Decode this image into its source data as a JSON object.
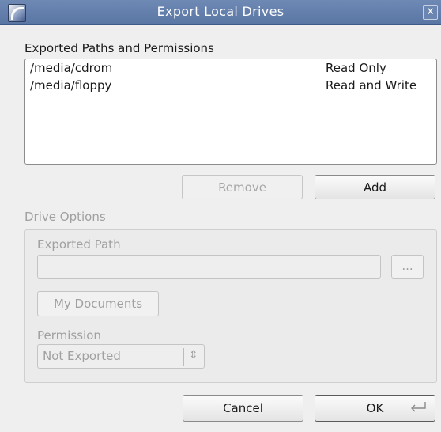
{
  "window": {
    "title": "Export Local Drives",
    "close_label": "x"
  },
  "exported": {
    "section_label": "Exported Paths and Permissions",
    "rows": [
      {
        "path": "/media/cdrom",
        "permission": "Read Only"
      },
      {
        "path": "/media/floppy",
        "permission": "Read and Write"
      }
    ]
  },
  "actions": {
    "remove_label": "Remove",
    "add_label": "Add"
  },
  "drive_options": {
    "label": "Drive Options",
    "exported_path_label": "Exported Path",
    "exported_path_value": "",
    "browse_label": "...",
    "my_documents_label": "My Documents",
    "permission_label": "Permission",
    "permission_value": "Not Exported",
    "spinner_glyph": "⇕"
  },
  "footer": {
    "cancel_label": "Cancel",
    "ok_label": "OK"
  }
}
